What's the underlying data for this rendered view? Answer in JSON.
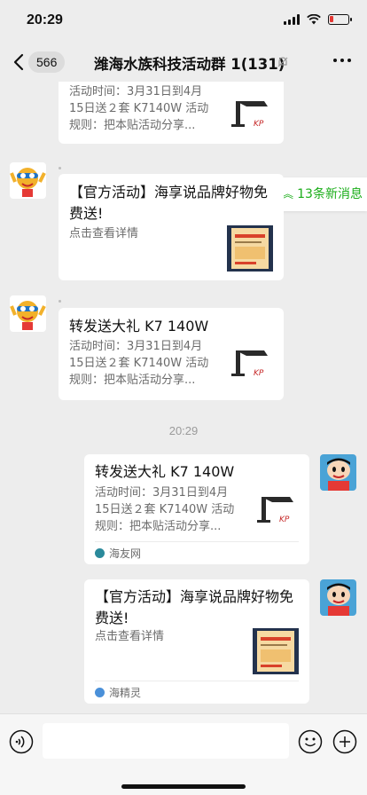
{
  "status": {
    "time": "20:29",
    "battery_level": 0.22
  },
  "nav": {
    "back_count": "566",
    "title": "潍海水族科技活动群 1(131)"
  },
  "new_messages": "13条新消息",
  "messages": [
    {
      "title": "",
      "desc": [
        "活动时间：3月31日到4月",
        "15日送２套 K7140W 活动",
        "规则：把本贴活动分享..."
      ]
    },
    {
      "title": "【官方活动】海享说品牌好物免费送!",
      "desc": [
        "点击查看详情"
      ]
    },
    {
      "title": "转发送大礼 K7 140W",
      "desc": [
        "活动时间：3月31日到4月",
        "15日送２套 K7140W 活动",
        "规则：把本贴活动分享..."
      ]
    },
    {
      "title": "转发送大礼 K7 140W",
      "desc": [
        "活动时间：3月31日到4月",
        "15日送２套 K7140W 活动",
        "规则：把本贴活动分享..."
      ],
      "source": "海友网"
    },
    {
      "title": "【官方活动】海享说品牌好物免费送!",
      "desc": [
        "点击查看详情"
      ],
      "source": "海精灵"
    }
  ],
  "time_label": "20:29",
  "colors": {
    "accent": "#1aad19",
    "chat_bg": "#ededed",
    "card_bg": "#ffffff"
  },
  "icons": [
    "back-chevron-icon",
    "mute-bell-icon",
    "more-dots-icon",
    "voice-icon",
    "emoji-icon",
    "plus-icon"
  ]
}
